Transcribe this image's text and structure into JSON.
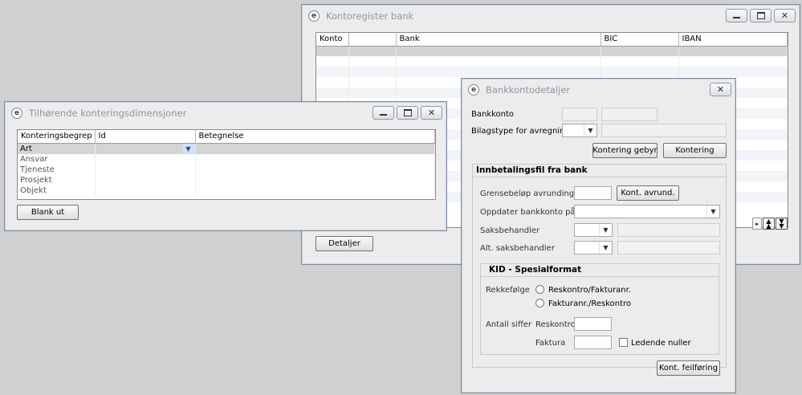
{
  "kontoregister": {
    "title": "Kontoregister bank",
    "columns": [
      "Konto",
      "",
      "Bank",
      "BIC",
      "IBAN"
    ],
    "detaljer_button": "Detaljer"
  },
  "dimensjoner": {
    "title": "Tilhørende konteringsdimensjoner",
    "columns": [
      "Konteringsbegrep",
      "Id",
      "Betegnelse"
    ],
    "rows": [
      "Art",
      "Ansvar",
      "Tjeneste",
      "Prosjekt",
      "Objekt"
    ],
    "blank_button": "Blank ut"
  },
  "detaljer": {
    "title": "Bankkontodetaljer",
    "bankkonto_label": "Bankkonto",
    "bilagstype_label": "Bilagstype for avregning",
    "kontering_gebyr_button": "Kontering gebyr",
    "kontering_button": "Kontering",
    "innbetaling_header": "Innbetalingsfil fra bank",
    "grensebelop_label": "Grensebeløp avrunding",
    "kont_avrund_button": "Kont. avrund.",
    "oppdater_label": "Oppdater bankkonto på",
    "saksbehandler_label": "Saksbehandler",
    "alt_saksbehandler_label": "Alt. saksbehandler",
    "kid_header": "KID - Spesialformat",
    "rekkefolge_label": "Rekkefølge",
    "radio_reskontro": "Reskontro/Fakturanr.",
    "radio_faktura": "Fakturanr./Reskontro",
    "antall_siffer_label": "Antall siffer",
    "reskontro_label": "Reskontro",
    "faktura_label": "Faktura",
    "ledende_nuller_label": "Ledende nuller",
    "kont_feilforing_button": "Kont. feilføring"
  },
  "icons": {
    "app": "app-logo-icon",
    "minimize": "minimize-icon",
    "maximize": "maximize-icon",
    "close": "close-icon",
    "dropdown": "chevron-down-icon",
    "scroll_up": "scroll-up-icon",
    "scroll_down": "scroll-down-icon"
  }
}
